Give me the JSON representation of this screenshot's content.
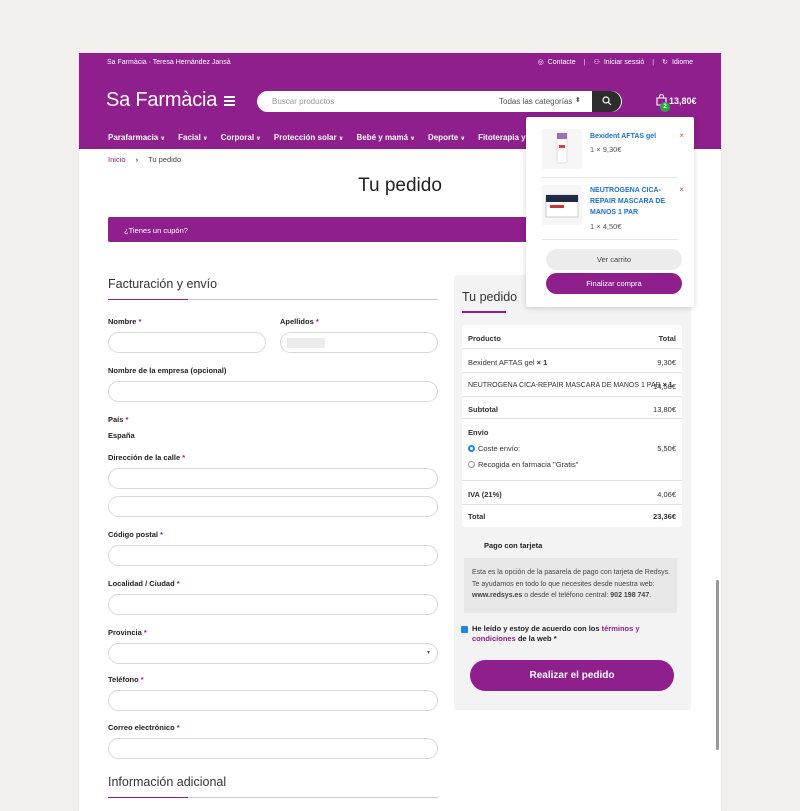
{
  "topbar": {
    "site_owner": "Sa Farmàcia · Teresa Hernández Jansà",
    "contact": "Contacte",
    "login": "Iniciar sessió",
    "language": "Idiome"
  },
  "header": {
    "logo": "Sa Farmàcia",
    "search_placeholder": "Buscar productos",
    "category_select": "Todas las categorías",
    "cart_count": "2",
    "cart_total": "13,80€"
  },
  "nav": [
    "Parafarmacia",
    "Facial",
    "Corporal",
    "Protección solar",
    "Bebé y mamá",
    "Deporte",
    "Fitoterapia y"
  ],
  "breadcrumb": {
    "home": "Inicio",
    "current": "Tu pedido"
  },
  "page_title": "Tu pedido",
  "coupon_text": "¿Tienes un cupón?",
  "billing": {
    "title": "Facturación y envío",
    "name_label": "Nombre",
    "surname_label": "Apellidos",
    "company_label": "Nombre de la empresa (opcional)",
    "country_label": "País",
    "country_value": "España",
    "street_label": "Dirección de la calle",
    "postcode_label": "Código postal",
    "city_label": "Localidad / Ciudad",
    "province_label": "Provincia",
    "phone_label": "Teléfono",
    "email_label": "Correo electrónico",
    "required_mark": "*"
  },
  "additional_title": "Información adicional",
  "order": {
    "title": "Tu pedido",
    "col_product": "Producto",
    "col_total": "Total",
    "items": [
      {
        "name": "Bexident AFTAS gel",
        "qty": "× 1",
        "total": "9,30€"
      },
      {
        "name": "NEUTROGENA CICA-REPAIR MASCARA DE MANOS 1 PAR",
        "qty": "× 1",
        "total": "14,50€"
      }
    ],
    "subtotal_label": "Subtotal",
    "subtotal_value": "13,80€",
    "shipping_label": "Envío",
    "shipping_option_1": "Coste envío:",
    "shipping_option_1_value": "5,50€",
    "shipping_option_2": "Recogida en farmacia \"Gratis\"",
    "tax_label": "IVA (21%)",
    "tax_value": "4,06€",
    "total_label": "Total",
    "total_value": "23,36€",
    "payment_title": "Pago con tarjeta",
    "payment_desc_1": "Esta es la opción de la pasarela de pago con tarjeta de Redsys. Te ayudamos en todo lo que necesites desde nuestra web: ",
    "payment_desc_web": "www.redsys.es",
    "payment_desc_2": " o desde el teléfono central: ",
    "payment_desc_phone": "902 198 747",
    "payment_desc_end": ".",
    "terms_pre": "He leído y estoy de acuerdo con los ",
    "terms_link": "términos y condiciones",
    "terms_post": " de la web *",
    "place_order": "Realizar el pedido"
  },
  "mini_cart": {
    "items": [
      {
        "name": "Bexident AFTAS gel",
        "qty": "1 × 9,30€"
      },
      {
        "name": "NEUTROGENA CICA-REPAIR MASCARA DE MANOS 1 PAR",
        "qty": "1 × 4,50€"
      }
    ],
    "remove": "×",
    "view_cart": "Ver carrito",
    "checkout": "Finalizar compra"
  },
  "colors": {
    "brand": "#8e1f8c",
    "link": "#1e6fd0",
    "check": "#1e88e5"
  }
}
